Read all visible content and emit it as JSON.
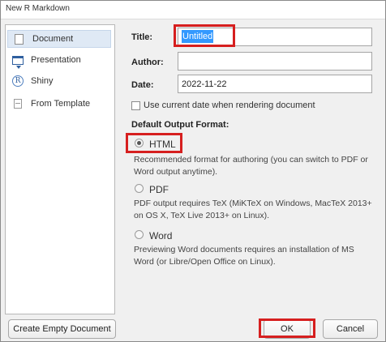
{
  "window": {
    "title": "New R Markdown"
  },
  "sidebar": {
    "items": [
      {
        "label": "Document",
        "icon": "document-icon",
        "selected": true
      },
      {
        "label": "Presentation",
        "icon": "presentation-icon",
        "selected": false
      },
      {
        "label": "Shiny",
        "icon": "shiny-icon",
        "icon_text": "R",
        "selected": false
      },
      {
        "label": "From Template",
        "icon": "template-icon",
        "selected": false
      }
    ]
  },
  "form": {
    "title_label": "Title:",
    "title_value": "Untitled",
    "author_label": "Author:",
    "author_value": "",
    "date_label": "Date:",
    "date_value": "2022-11-22",
    "use_current_date_label": "Use current date when rendering document",
    "use_current_date_checked": false,
    "output_format_heading": "Default Output Format:"
  },
  "output_formats": [
    {
      "label": "HTML",
      "checked": true,
      "description": "Recommended format for authoring (you can switch to PDF or Word output anytime)."
    },
    {
      "label": "PDF",
      "checked": false,
      "description": "PDF output requires TeX (MiKTeX on Windows, MacTeX 2013+ on OS X, TeX Live 2013+ on Linux)."
    },
    {
      "label": "Word",
      "checked": false,
      "description": "Previewing Word documents requires an installation of MS Word (or Libre/Open Office on Linux)."
    }
  ],
  "buttons": {
    "create_empty": "Create Empty Document",
    "ok": "OK",
    "cancel": "Cancel"
  },
  "colors": {
    "highlight": "#d61f1f",
    "selection": "#3399ff",
    "sidebar_selected": "#dfe9f5"
  }
}
